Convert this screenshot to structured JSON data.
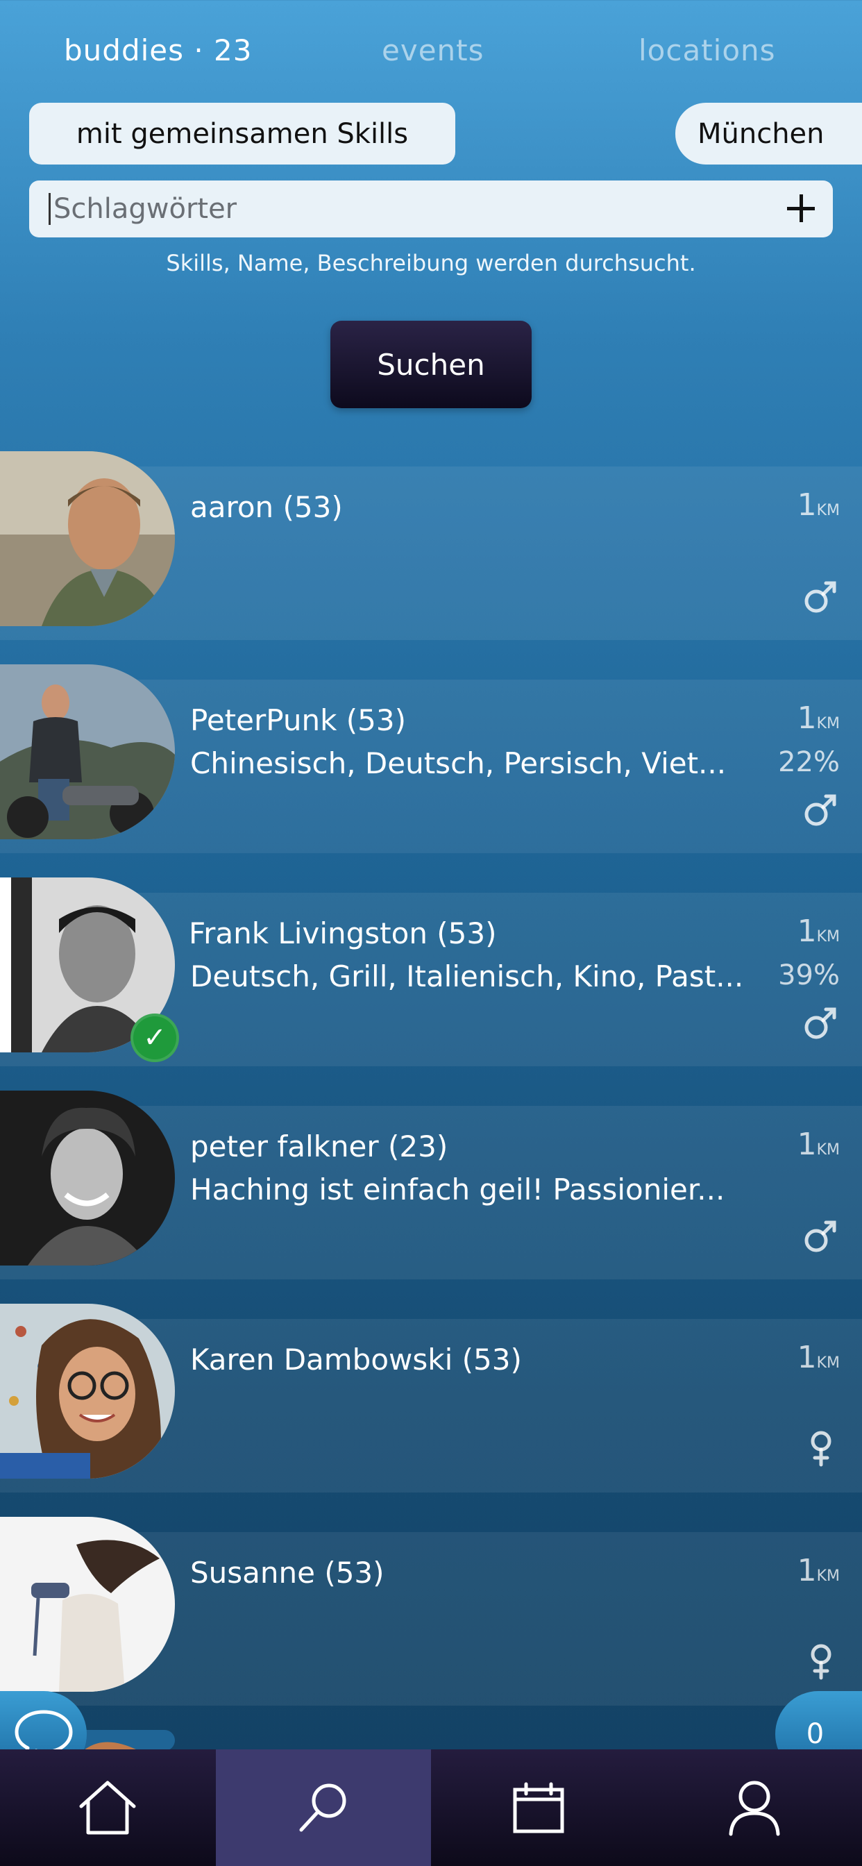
{
  "tabs": [
    {
      "label": "buddies · 23",
      "active": true
    },
    {
      "label": "events",
      "active": false
    },
    {
      "label": "locations",
      "active": false
    }
  ],
  "filters": {
    "skills_label": "mit gemeinsamen Skills",
    "city_label": "München"
  },
  "search": {
    "placeholder": "Schlagwörter",
    "value": "",
    "hint": "Skills, Name, Beschreibung werden durchsucht.",
    "button_label": "Suchen"
  },
  "users": [
    {
      "name": "aaron (53)",
      "description": "",
      "distance": "1",
      "distance_unit": "KM",
      "match": "",
      "gender": "male",
      "verified": false
    },
    {
      "name": "PeterPunk (53)",
      "description": "Chinesisch, Deutsch, Persisch, Viet...",
      "distance": "1",
      "distance_unit": "KM",
      "match": "22%",
      "gender": "male",
      "verified": false
    },
    {
      "name": "Frank Livingston (53)",
      "description": "Deutsch, Grill, Italienisch, Kino, Past...",
      "distance": "1",
      "distance_unit": "KM",
      "match": "39%",
      "gender": "male",
      "verified": true
    },
    {
      "name": "peter falkner (23)",
      "description": "Haching ist einfach geil! Passionier...",
      "distance": "1",
      "distance_unit": "KM",
      "match": "",
      "gender": "male",
      "verified": false
    },
    {
      "name": "Karen Dambowski (53)",
      "description": "",
      "distance": "1",
      "distance_unit": "KM",
      "match": "",
      "gender": "female",
      "verified": false
    },
    {
      "name": "Susanne (53)",
      "description": "",
      "distance": "1",
      "distance_unit": "KM",
      "match": "",
      "gender": "female",
      "verified": false
    }
  ],
  "floating": {
    "chat_icon": "chat-bubble-icon",
    "count": "0"
  },
  "bottom_nav": [
    {
      "icon": "home-icon",
      "active": false
    },
    {
      "icon": "search-icon",
      "active": true
    },
    {
      "icon": "calendar-icon",
      "active": false
    },
    {
      "icon": "profile-icon",
      "active": false
    }
  ],
  "colors": {
    "accent_dark": "#0d0a1d",
    "nav_active": "#3d3a6e",
    "verified_green": "#1f9a3b"
  }
}
